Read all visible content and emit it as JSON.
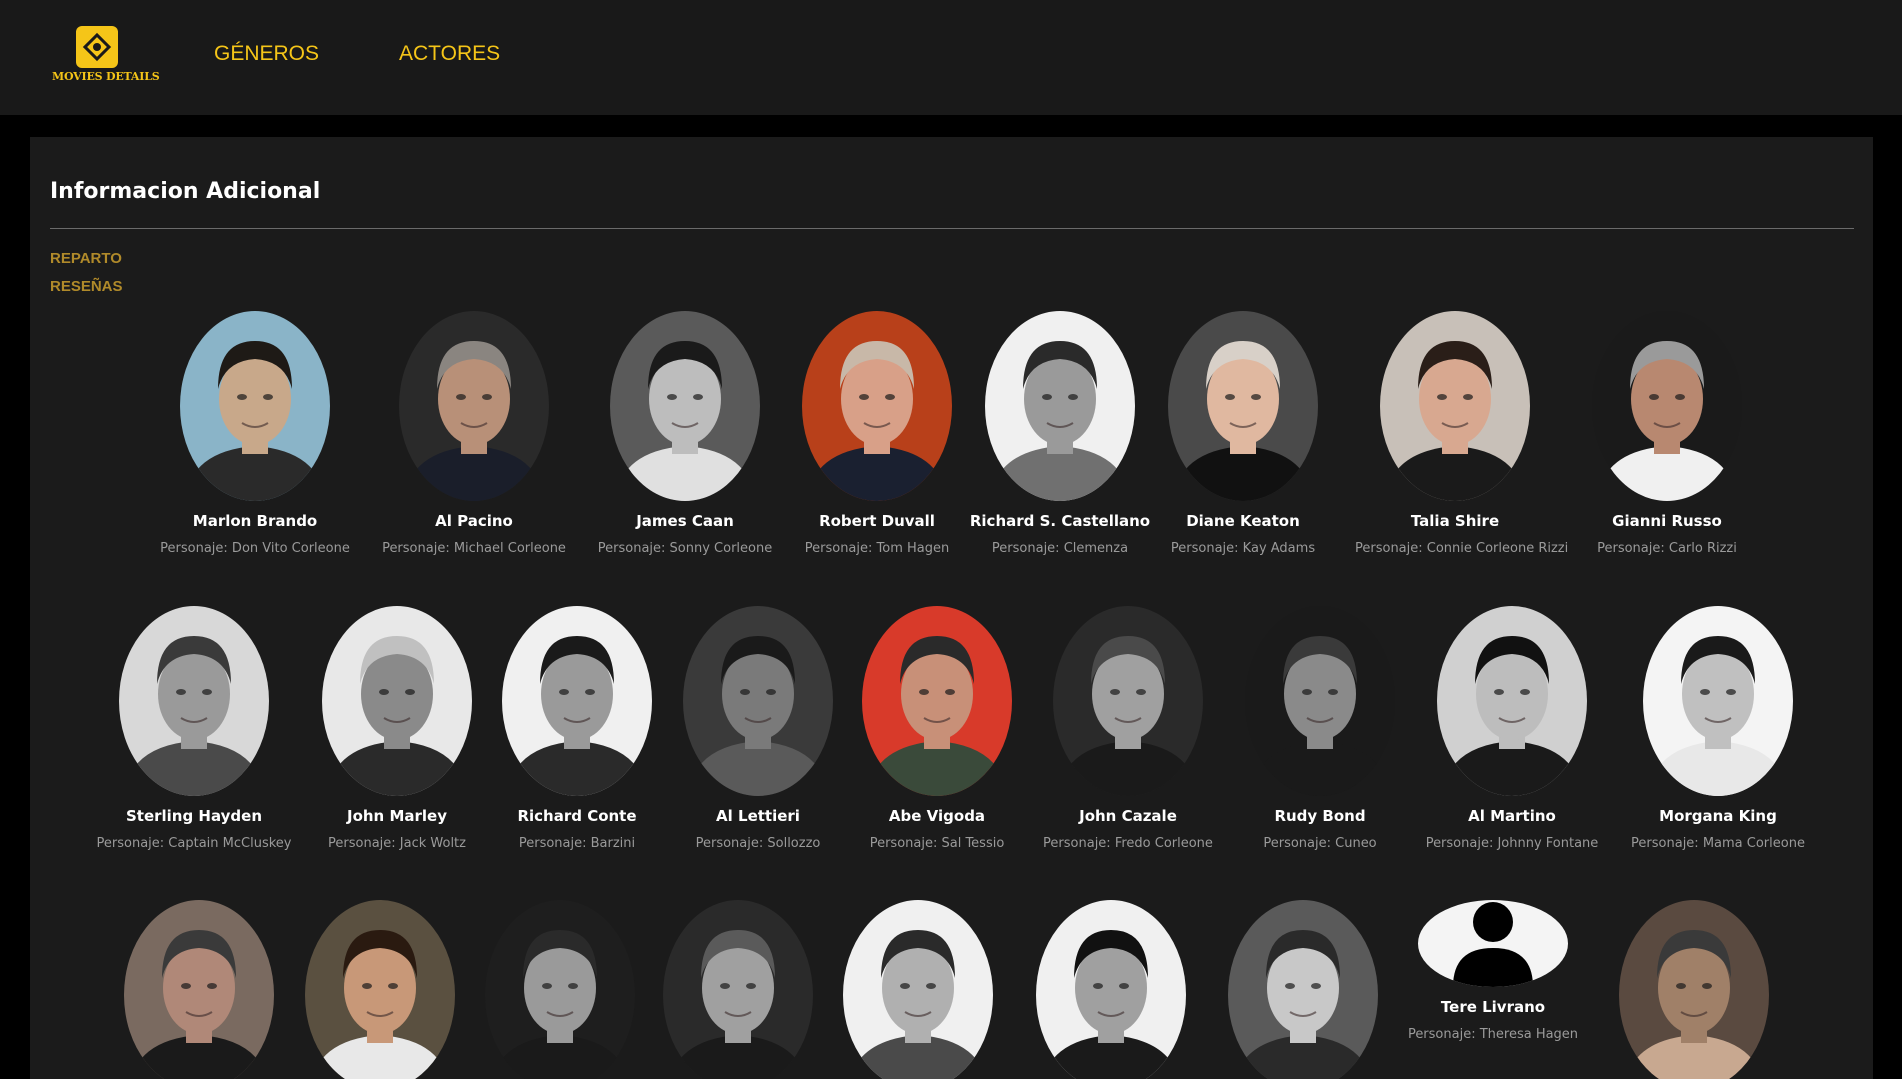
{
  "header": {
    "logo_text": "MOVIES DETAILS",
    "nav": [
      {
        "label": "GÉNEROS"
      },
      {
        "label": "ACTORES"
      }
    ]
  },
  "section": {
    "title": "Informacion Adicional",
    "links": [
      {
        "label": "REPARTO"
      },
      {
        "label": "RESEÑAS"
      }
    ]
  },
  "cast": [
    {
      "name": "Marlon Brando",
      "character": "Personaje: Don Vito Corleone",
      "bg": "#8ab4c8",
      "tone": "#c8a88a",
      "hair": "#1e1a16",
      "suit": "#2a2a2a"
    },
    {
      "name": "Al Pacino",
      "character": "Personaje: Michael Corleone",
      "bg": "#2a2a2a",
      "tone": "#b89078",
      "hair": "#8a8580",
      "suit": "#1a1e2a"
    },
    {
      "name": "James Caan",
      "character": "Personaje: Sonny Corleone",
      "bg": "#5a5a5a",
      "tone": "#bdbdbd",
      "hair": "#1a1a1a",
      "suit": "#e0e0e0"
    },
    {
      "name": "Robert Duvall",
      "character": "Personaje: Tom Hagen",
      "bg": "#b8401a",
      "tone": "#d8a088",
      "hair": "#c8b8a8",
      "suit": "#1a2030"
    },
    {
      "name": "Richard S. Castellano",
      "character": "Personaje: Clemenza",
      "bg": "#f0f0f0",
      "tone": "#9a9a9a",
      "hair": "#2a2a2a",
      "suit": "#707070"
    },
    {
      "name": "Diane Keaton",
      "character": "Personaje: Kay Adams",
      "bg": "#4a4a4a",
      "tone": "#e0b8a0",
      "hair": "#d8d0c8",
      "suit": "#111111"
    },
    {
      "name": "Talia Shire",
      "character": "Personaje: Connie Corleone Rizzi",
      "bg": "#c8c0b8",
      "tone": "#d8a890",
      "hair": "#2a1e18",
      "suit": "#1a1a1a"
    },
    {
      "name": "Gianni Russo",
      "character": "Personaje: Carlo Rizzi",
      "bg": "#1a1a1a",
      "tone": "#b88870",
      "hair": "#9a9a9a",
      "suit": "#f0f0f0"
    },
    {
      "name": "Sterling Hayden",
      "character": "Personaje: Captain McCluskey",
      "bg": "#d8d8d8",
      "tone": "#9a9a9a",
      "hair": "#3a3a3a",
      "suit": "#4a4a4a"
    },
    {
      "name": "John Marley",
      "character": "Personaje: Jack Woltz",
      "bg": "#e8e8e8",
      "tone": "#8a8a8a",
      "hair": "#c0c0c0",
      "suit": "#2a2a2a"
    },
    {
      "name": "Richard Conte",
      "character": "Personaje: Barzini",
      "bg": "#f0f0f0",
      "tone": "#9a9a9a",
      "hair": "#1a1a1a",
      "suit": "#2a2a2a"
    },
    {
      "name": "Al Lettieri",
      "character": "Personaje: Sollozzo",
      "bg": "#3a3a3a",
      "tone": "#7a7a7a",
      "hair": "#1a1a1a",
      "suit": "#5a5a5a"
    },
    {
      "name": "Abe Vigoda",
      "character": "Personaje: Sal Tessio",
      "bg": "#d83a2a",
      "tone": "#c89078",
      "hair": "#2a2a2a",
      "suit": "#3a4a3a"
    },
    {
      "name": "John Cazale",
      "character": "Personaje: Fredo Corleone",
      "bg": "#2a2a2a",
      "tone": "#a0a0a0",
      "hair": "#4a4a4a",
      "suit": "#1a1a1a"
    },
    {
      "name": "Rudy Bond",
      "character": "Personaje: Cuneo",
      "bg": "#1a1a1a",
      "tone": "#8a8a8a",
      "hair": "#3a3a3a",
      "suit": "#1a1a1a"
    },
    {
      "name": "Al Martino",
      "character": "Personaje: Johnny Fontane",
      "bg": "#d0d0d0",
      "tone": "#bdbdbd",
      "hair": "#111111",
      "suit": "#1a1a1a"
    },
    {
      "name": "Morgana King",
      "character": "Personaje: Mama Corleone",
      "bg": "#f4f4f4",
      "tone": "#c0c0c0",
      "hair": "#1a1a1a",
      "suit": "#e8e8e8"
    },
    {
      "name": "",
      "character": "",
      "bg": "#7a6a60",
      "tone": "#b08878",
      "hair": "#3a3a3a",
      "suit": "#1a1a1a"
    },
    {
      "name": "",
      "character": "",
      "bg": "#5a5040",
      "tone": "#c89878",
      "hair": "#2a1a10",
      "suit": "#e8e8e8"
    },
    {
      "name": "",
      "character": "",
      "bg": "#1e1e1e",
      "tone": "#9a9a9a",
      "hair": "#2a2a2a",
      "suit": "#1a1a1a"
    },
    {
      "name": "",
      "character": "",
      "bg": "#2a2a2a",
      "tone": "#a0a0a0",
      "hair": "#5a5a5a",
      "suit": "#1a1a1a"
    },
    {
      "name": "",
      "character": "",
      "bg": "#f0f0f0",
      "tone": "#b0b0b0",
      "hair": "#2a2a2a",
      "suit": "#4a4a4a"
    },
    {
      "name": "",
      "character": "",
      "bg": "#f0f0f0",
      "tone": "#a0a0a0",
      "hair": "#111111",
      "suit": "#1a1a1a"
    },
    {
      "name": "",
      "character": "",
      "bg": "#5a5a5a",
      "tone": "#c8c8c8",
      "hair": "#2a2a2a",
      "suit": "#2a2a2a"
    },
    {
      "name": "Tere Livrano",
      "character": "Personaje: Theresa Hagen",
      "placeholder": true,
      "bg": "#f4f4f4",
      "tone": "#000000",
      "hair": "#000000",
      "suit": "#000000"
    },
    {
      "name": "",
      "character": "",
      "bg": "#5a4a40",
      "tone": "#a08068",
      "hair": "#3a3a3a",
      "suit": "#c8a890"
    }
  ]
}
